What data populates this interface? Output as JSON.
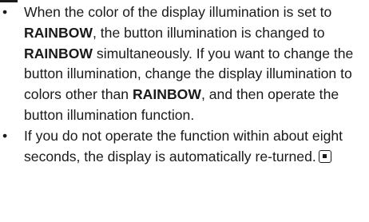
{
  "notes": [
    {
      "bullet": "•",
      "segments": [
        {
          "text": "When the color of the display illumination is set to ",
          "bold": false
        },
        {
          "text": "RAINBOW",
          "bold": true
        },
        {
          "text": ", the button illumination is changed to ",
          "bold": false
        },
        {
          "text": "RAINBOW",
          "bold": true
        },
        {
          "text": " simultaneously. If you want to change the button illumination, change the display illumination to colors other than ",
          "bold": false
        },
        {
          "text": "RAINBOW",
          "bold": true
        },
        {
          "text": ", and then operate the button illumination function.",
          "bold": false
        }
      ]
    },
    {
      "bullet": "•",
      "segments": [
        {
          "text": "If you do not operate the function within about eight seconds, the display is automatically re-turned.",
          "bold": false
        }
      ],
      "end_mark_icon": "end-of-section-icon"
    }
  ]
}
